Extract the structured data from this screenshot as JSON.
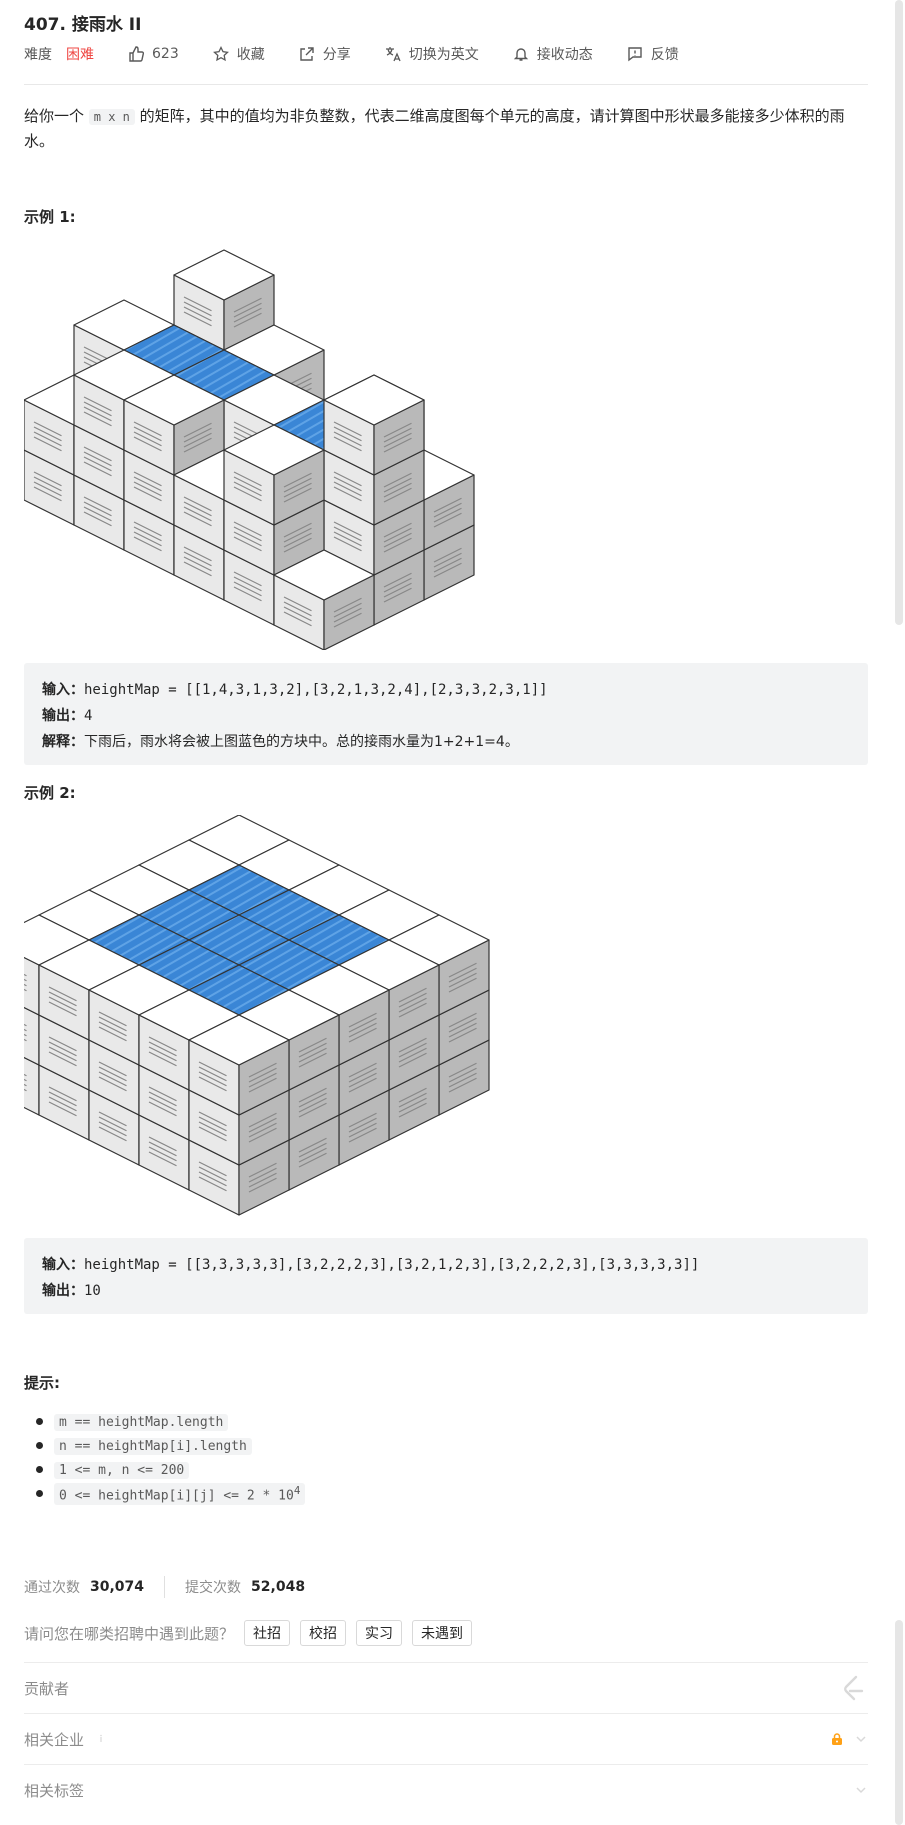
{
  "problem": {
    "title": "407. 接雨水 II",
    "difficulty_label": "难度",
    "difficulty": "困难",
    "likes": "623",
    "favorite": "收藏",
    "share": "分享",
    "switch_lang": "切换为英文",
    "subscribe": "接收动态",
    "feedback": "反馈"
  },
  "description": {
    "pre": "给你一个 ",
    "code": "m x n",
    "post": " 的矩阵，其中的值均为非负整数，代表二维高度图每个单元的高度，请计算图中形状最多能接多少体积的雨水。"
  },
  "example1": {
    "heading": "示例 1:",
    "input_label": "输入：",
    "input": "heightMap = [[1,4,3,1,3,2],[3,2,1,3,2,4],[2,3,3,2,3,1]]",
    "output_label": "输出：",
    "output": "4",
    "explain_label": "解释：",
    "explain": "下雨后，雨水将会被上图蓝色的方块中。总的接雨水量为1+2+1=4。"
  },
  "example2": {
    "heading": "示例 2:",
    "input_label": "输入：",
    "input": "heightMap = [[3,3,3,3,3],[3,2,2,2,3],[3,2,1,2,3],[3,2,2,2,3],[3,3,3,3,3]]",
    "output_label": "输出：",
    "output": "10"
  },
  "tips": {
    "heading": "提示:",
    "items": [
      "m == heightMap.length",
      "n == heightMap[i].length",
      "1 <= m, n <= 200",
      "0 <= heightMap[i][j] <= 2 * 10"
    ],
    "last_sup": "4"
  },
  "stats": {
    "passed_label": "通过次数",
    "passed": "30,074",
    "submitted_label": "提交次数",
    "submitted": "52,048"
  },
  "recruit": {
    "question": "请问您在哪类招聘中遇到此题？",
    "options": [
      "社招",
      "校招",
      "实习",
      "未遇到"
    ]
  },
  "sections": {
    "contributors": "贡献者",
    "companies": "相关企业",
    "tags": "相关标签"
  },
  "colors": {
    "hard": "#ef4743",
    "water": "#3a86d6",
    "lock": "#ffa116"
  }
}
